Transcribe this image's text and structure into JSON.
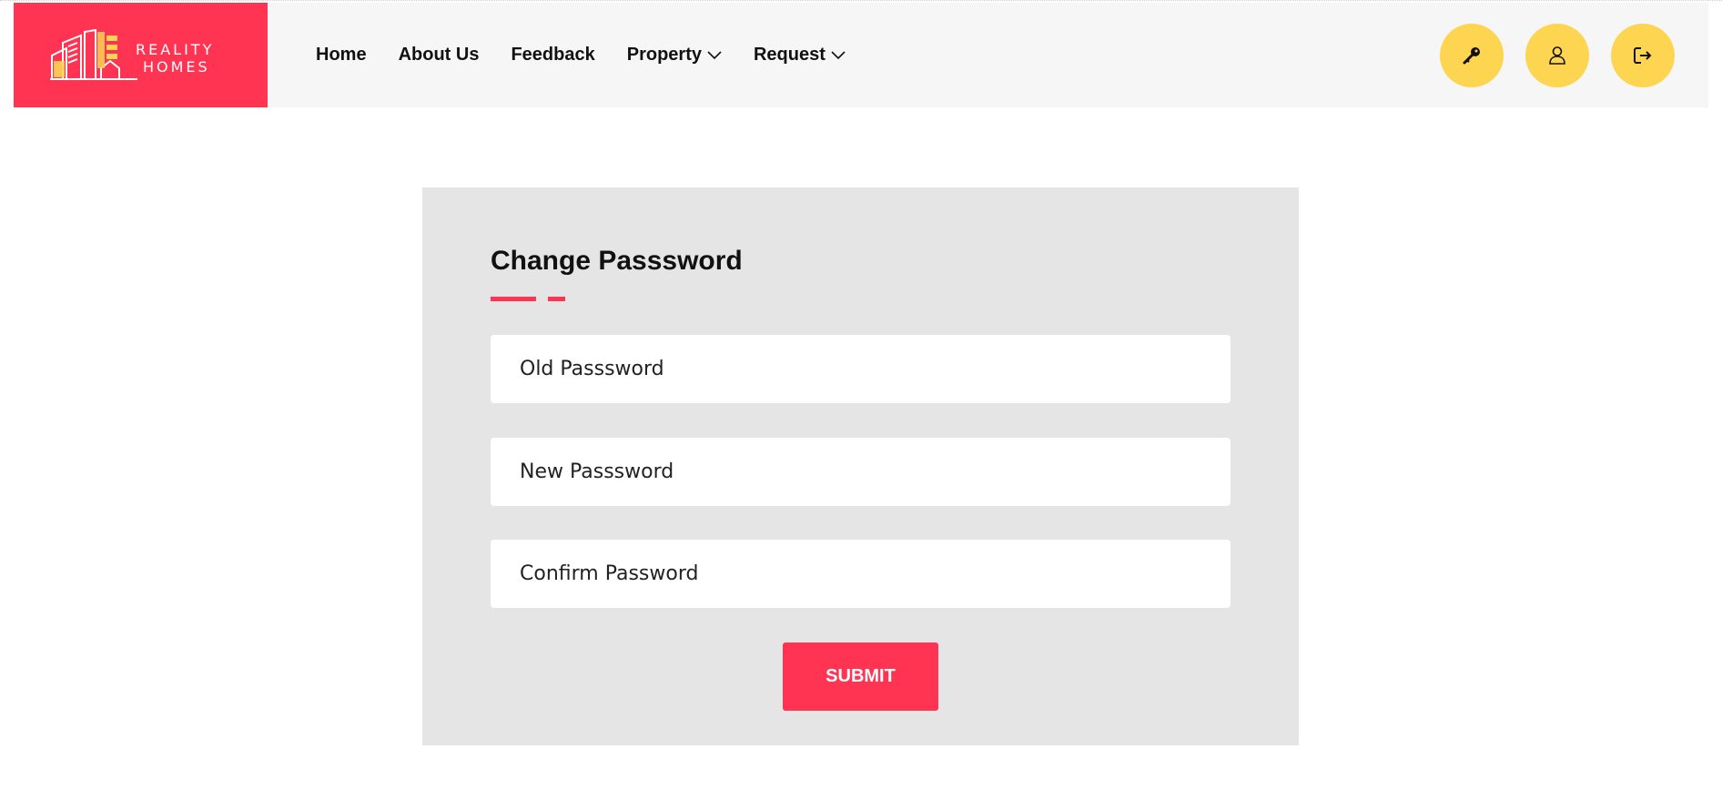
{
  "brand": {
    "line1": "REALITY",
    "line2": "HOMES",
    "color": "#ff3352"
  },
  "nav": {
    "items": [
      {
        "label": "Home",
        "dropdown": false
      },
      {
        "label": "About Us",
        "dropdown": false
      },
      {
        "label": "Feedback",
        "dropdown": false
      },
      {
        "label": "Property",
        "dropdown": true
      },
      {
        "label": "Request",
        "dropdown": true
      }
    ]
  },
  "header_actions": {
    "icons": [
      "key-icon",
      "user-icon",
      "logout-icon"
    ],
    "color": "#fdd551"
  },
  "form": {
    "title": "Change Passsword",
    "old_password_placeholder": "Old Passsword",
    "new_password_placeholder": "New Passsword",
    "confirm_password_placeholder": "Confirm Password",
    "submit_label": "SUBMIT"
  },
  "colors": {
    "accent": "#ff3352",
    "icon_button": "#fdd551",
    "header_bg": "#f6f6f6",
    "card_bg": "#e5e5e5"
  }
}
